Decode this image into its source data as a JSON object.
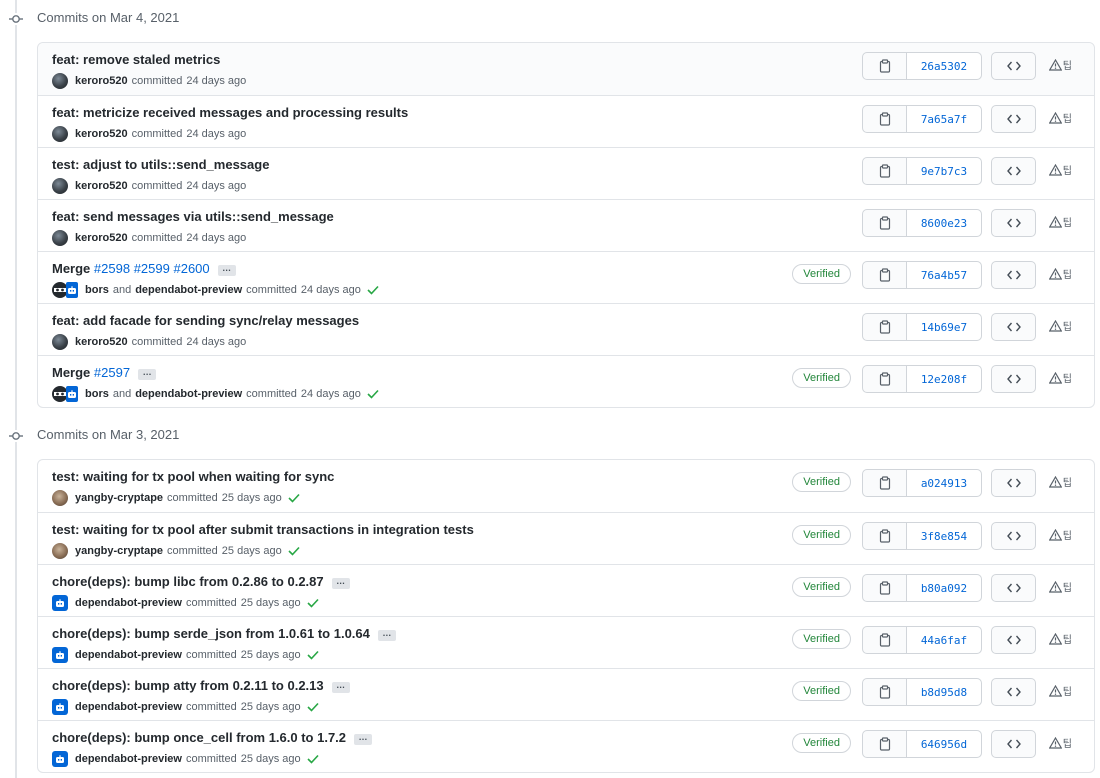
{
  "colors": {
    "link": "#0366d6",
    "verified": "#22863a",
    "border": "#e1e4e8",
    "muted": "#586069"
  },
  "groups": [
    {
      "date_label": "Commits on Mar 4, 2021",
      "commits": [
        {
          "message": "feat: remove staled metrics",
          "avatar": "keroro",
          "author": "keroro520",
          "committed_label": "committed",
          "time": "24 days ago",
          "verified": false,
          "sha": "26a5302"
        },
        {
          "message": "feat: metricize received messages and processing results",
          "avatar": "keroro",
          "author": "keroro520",
          "committed_label": "committed",
          "time": "24 days ago",
          "verified": false,
          "sha": "7a65a7f"
        },
        {
          "message": "test: adjust to utils::send_message",
          "avatar": "keroro",
          "author": "keroro520",
          "committed_label": "committed",
          "time": "24 days ago",
          "verified": false,
          "sha": "9e7b7c3"
        },
        {
          "message": "feat: send messages via utils::send_message",
          "avatar": "keroro",
          "author": "keroro520",
          "committed_label": "committed",
          "time": "24 days ago",
          "verified": false,
          "sha": "8600e23"
        },
        {
          "message_prefix": "Merge",
          "prs": [
            "#2598",
            "#2599",
            "#2600"
          ],
          "ellipsis": "…",
          "avatar": "bors-pair",
          "author": "bors",
          "coauthor_join": "and",
          "coauthor": "dependabot-preview",
          "committed_label": "committed",
          "time": "24 days ago",
          "verified": true,
          "verified_label": "Verified",
          "check": true,
          "sha": "76a4b57"
        },
        {
          "message": "feat: add facade for sending sync/relay messages",
          "avatar": "keroro",
          "author": "keroro520",
          "committed_label": "committed",
          "time": "24 days ago",
          "verified": false,
          "sha": "14b69e7"
        },
        {
          "message_prefix": "Merge",
          "prs": [
            "#2597"
          ],
          "ellipsis": "…",
          "avatar": "bors-pair",
          "author": "bors",
          "coauthor_join": "and",
          "coauthor": "dependabot-preview",
          "committed_label": "committed",
          "time": "24 days ago",
          "verified": true,
          "verified_label": "Verified",
          "check": true,
          "sha": "12e208f"
        }
      ]
    },
    {
      "date_label": "Commits on Mar 3, 2021",
      "commits": [
        {
          "message": "test: waiting for tx pool when waiting for sync",
          "avatar": "yangby",
          "author": "yangby-cryptape",
          "committed_label": "committed",
          "time": "25 days ago",
          "verified": true,
          "verified_label": "Verified",
          "check": true,
          "sha": "a024913"
        },
        {
          "message": "test: waiting for tx pool after submit transactions in integration tests",
          "avatar": "yangby",
          "author": "yangby-cryptape",
          "committed_label": "committed",
          "time": "25 days ago",
          "verified": true,
          "verified_label": "Verified",
          "check": true,
          "sha": "3f8e854"
        },
        {
          "message": "chore(deps): bump libc from 0.2.86 to 0.2.87",
          "ellipsis": "…",
          "avatar": "dependabot",
          "author": "dependabot-preview",
          "committed_label": "committed",
          "time": "25 days ago",
          "verified": true,
          "verified_label": "Verified",
          "check": true,
          "sha": "b80a092"
        },
        {
          "message": "chore(deps): bump serde_json from 1.0.61 to 1.0.64",
          "ellipsis": "…",
          "avatar": "dependabot",
          "author": "dependabot-preview",
          "committed_label": "committed",
          "time": "25 days ago",
          "verified": true,
          "verified_label": "Verified",
          "check": true,
          "sha": "44a6faf"
        },
        {
          "message": "chore(deps): bump atty from 0.2.11 to 0.2.13",
          "ellipsis": "…",
          "avatar": "dependabot",
          "author": "dependabot-preview",
          "committed_label": "committed",
          "time": "25 days ago",
          "verified": true,
          "verified_label": "Verified",
          "check": true,
          "sha": "b8d95d8"
        },
        {
          "message": "chore(deps): bump once_cell from 1.6.0 to 1.7.2",
          "ellipsis": "…",
          "avatar": "dependabot",
          "author": "dependabot-preview",
          "committed_label": "committed",
          "time": "25 days ago",
          "verified": true,
          "verified_label": "Verified",
          "check": true,
          "sha": "646956d"
        }
      ]
    }
  ],
  "row_actions": {
    "warn_suffix": "팁",
    "copy_icon": "clipboard-icon",
    "browse_icon": "code-icon",
    "warn_icon": "alert-icon"
  }
}
